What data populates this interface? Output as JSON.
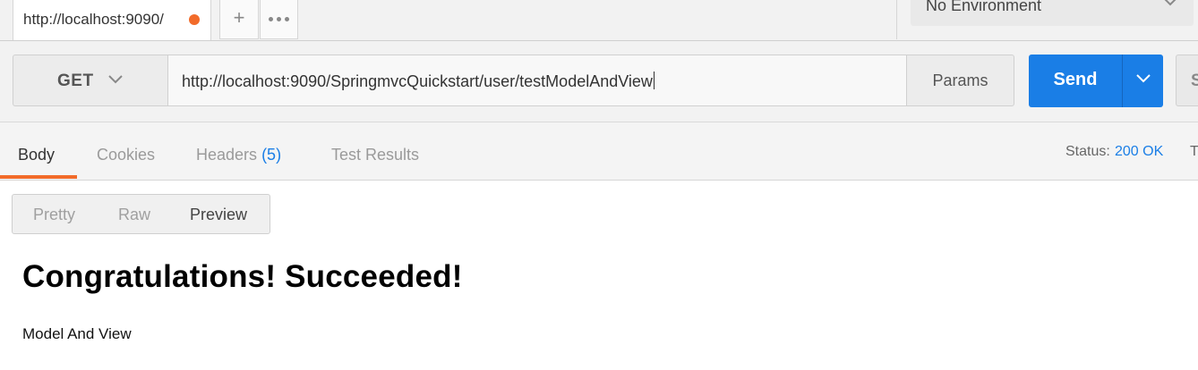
{
  "tabs": {
    "active_tab_title": "http://localhost:9090/",
    "new_tab_glyph": "+",
    "more_icon": "ellipsis-icon",
    "unsaved_dot_color": "#f26b2a"
  },
  "environment": {
    "selected": "No Environment"
  },
  "request": {
    "method": "GET",
    "url": "http://localhost:9090/SpringmvcQuickstart/user/testModelAndView",
    "params_label": "Params",
    "send_label": "Send",
    "save_label": "S",
    "send_color": "#1a7ee6"
  },
  "response_tabs": {
    "body": "Body",
    "cookies": "Cookies",
    "headers": "Headers",
    "headers_count": "(5)",
    "test_results": "Test Results",
    "active_accent": "#f26b2a"
  },
  "status": {
    "label": "Status:",
    "value": "200 OK",
    "time_label": "T"
  },
  "format": {
    "pretty": "Pretty",
    "raw": "Raw",
    "preview": "Preview",
    "selected": "Preview"
  },
  "preview": {
    "heading": "Congratulations! Succeeded!",
    "paragraph": "Model And View"
  }
}
